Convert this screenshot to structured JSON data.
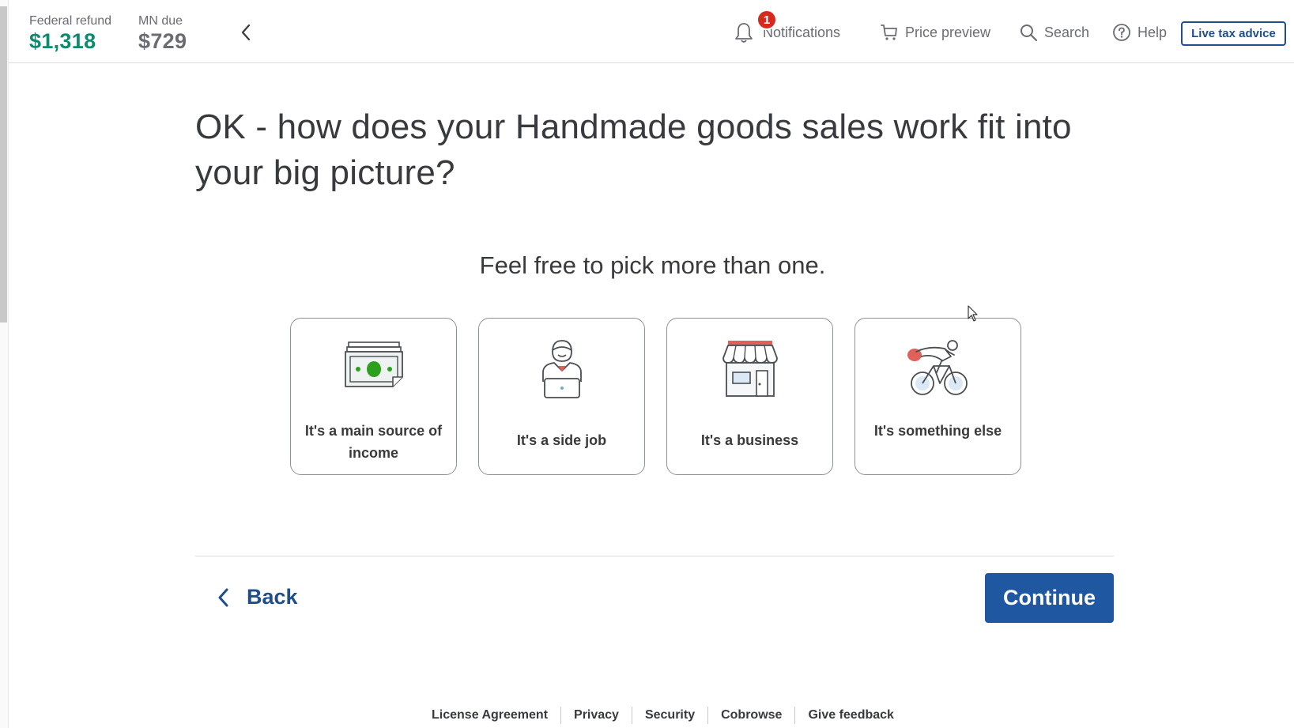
{
  "header": {
    "federal_refund_label": "Federal refund",
    "federal_refund_amount": "$1,318",
    "mn_due_label": "MN due",
    "mn_due_amount": "$729",
    "notifications_label": "Notifications",
    "notifications_count": "1",
    "price_preview_label": "Price preview",
    "search_label": "Search",
    "help_label": "Help",
    "live_tax_advice_label": "Live tax advice"
  },
  "main": {
    "question": "OK - how does your Handmade goods sales work fit into your big picture?",
    "subtitle": "Feel free to pick more than one.",
    "options": [
      {
        "label": "It's a main source of income",
        "icon": "money-icon"
      },
      {
        "label": "It's a side job",
        "icon": "person-laptop-icon"
      },
      {
        "label": "It's a business",
        "icon": "storefront-icon"
      },
      {
        "label": "It's something else",
        "icon": "cyclist-icon"
      }
    ],
    "back_label": "Back",
    "continue_label": "Continue"
  },
  "footer": {
    "links": [
      "License Agreement",
      "Privacy",
      "Security",
      "Cobrowse",
      "Give feedback"
    ]
  },
  "colors": {
    "refund_green": "#0f8a6c",
    "primary_blue": "#1f58a0",
    "badge_red": "#d52b1e"
  }
}
